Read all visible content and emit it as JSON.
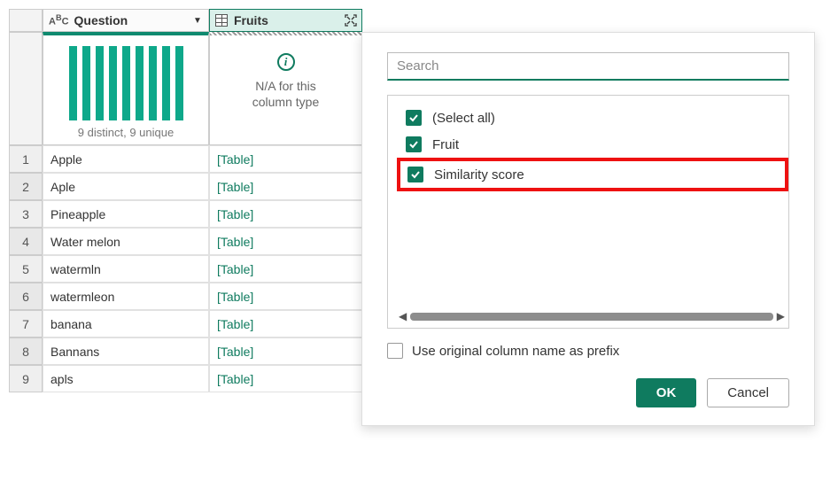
{
  "columns": {
    "question": {
      "label": "Question",
      "type_label": "ABC"
    },
    "fruits": {
      "label": "Fruits"
    }
  },
  "profile": {
    "distinct_text": "9 distinct, 9 unique",
    "na_line1": "N/A for this",
    "na_line2": "column type",
    "info_glyph": "i"
  },
  "rows": [
    {
      "n": "1",
      "q": "Apple",
      "f": "[Table]"
    },
    {
      "n": "2",
      "q": "Aple",
      "f": "[Table]"
    },
    {
      "n": "3",
      "q": "Pineapple",
      "f": "[Table]"
    },
    {
      "n": "4",
      "q": "Water melon",
      "f": "[Table]"
    },
    {
      "n": "5",
      "q": "watermln",
      "f": "[Table]"
    },
    {
      "n": "6",
      "q": "watermleon",
      "f": "[Table]"
    },
    {
      "n": "7",
      "q": "banana",
      "f": "[Table]"
    },
    {
      "n": "8",
      "q": "Bannans",
      "f": "[Table]"
    },
    {
      "n": "9",
      "q": "apls",
      "f": "[Table]"
    }
  ],
  "popup": {
    "search_placeholder": "Search",
    "items": [
      {
        "label": "(Select all)",
        "checked": true,
        "highlight": false
      },
      {
        "label": "Fruit",
        "checked": true,
        "highlight": false
      },
      {
        "label": "Similarity score",
        "checked": true,
        "highlight": true
      }
    ],
    "prefix_label": "Use original column name as prefix",
    "ok_label": "OK",
    "cancel_label": "Cancel"
  }
}
